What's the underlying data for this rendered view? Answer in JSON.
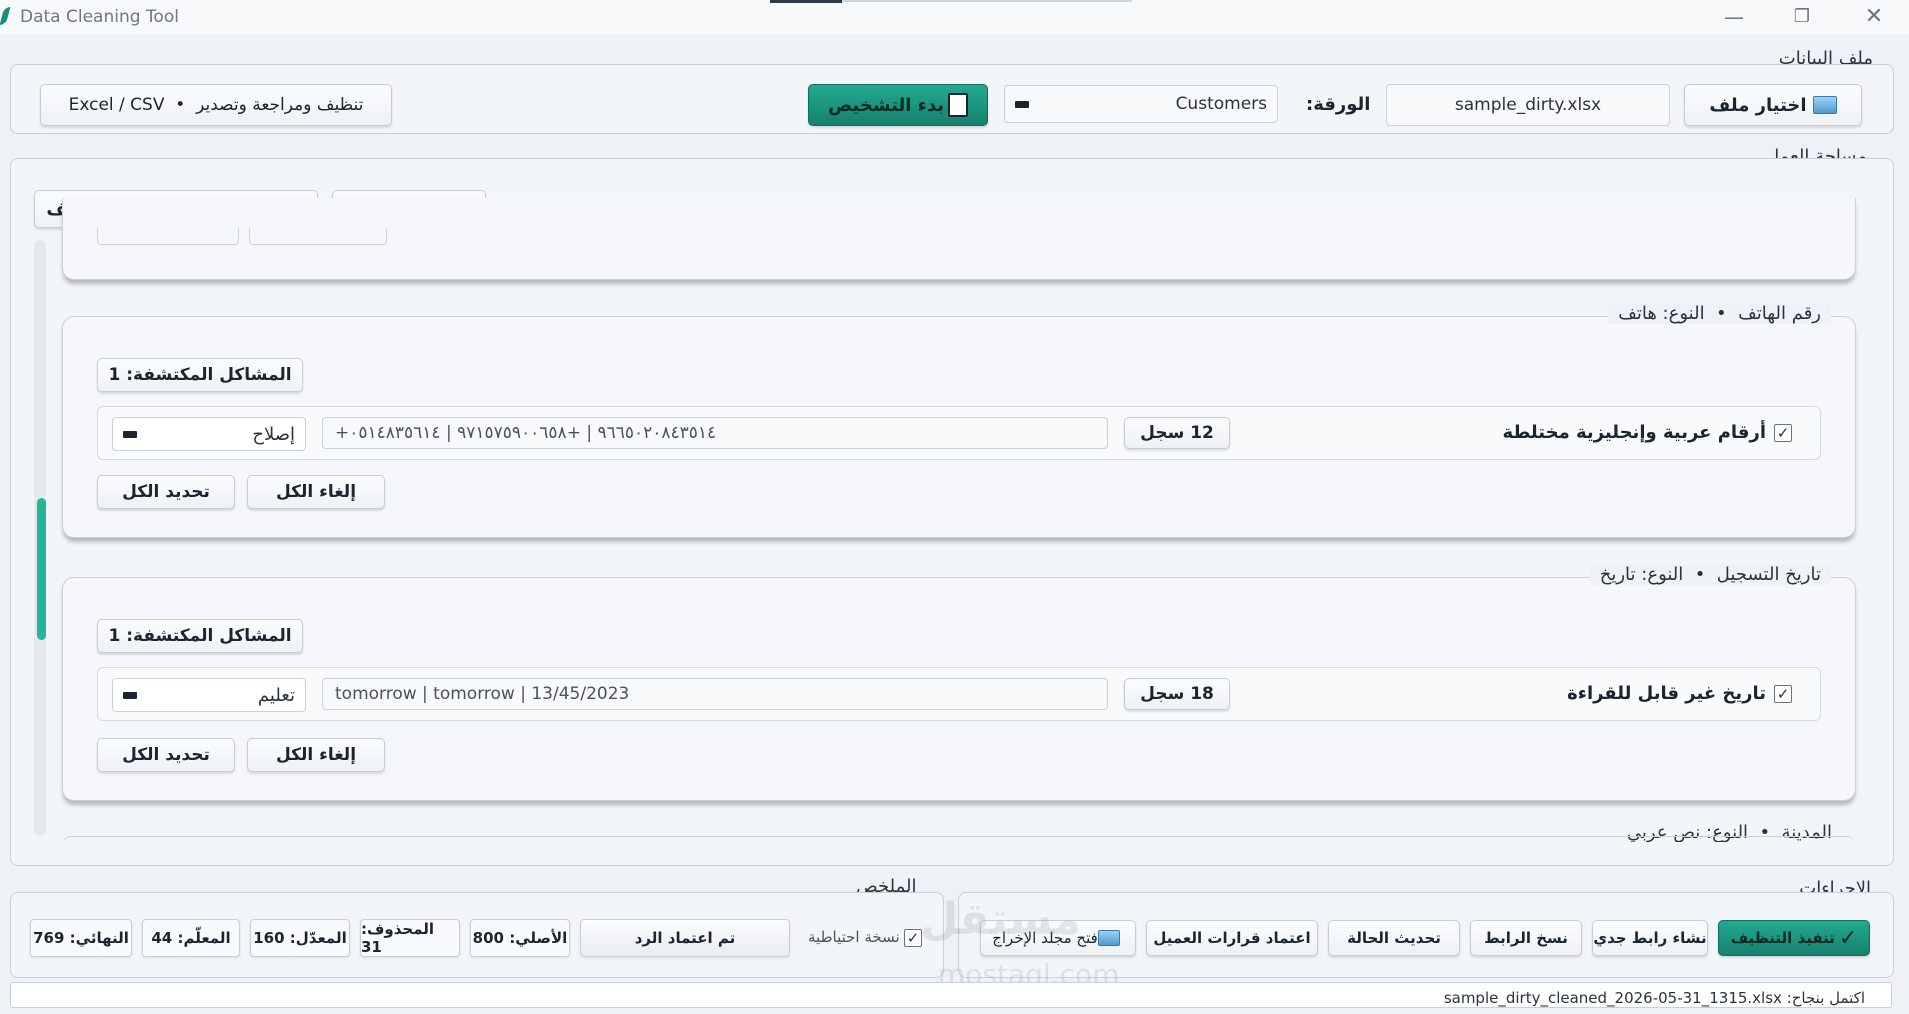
{
  "window": {
    "title": "Data Cleaning Tool",
    "min_glyph": "—",
    "max_glyph": "❐",
    "close_glyph": "✕"
  },
  "file_section": {
    "label": "ملف البيانات",
    "choose_file_label": "اختيار ملف",
    "file_name": "sample_dirty.xlsx",
    "sheet_label": "الورقة:",
    "sheet_value": "Customers",
    "diagnose_label": "بدء التشخيص",
    "tagline": "تنظيف ومراجعة وتصدير  •  Excel / CSV"
  },
  "workspace": {
    "label": "مساحة العمل",
    "select_all_issues": "تحديد كل المشاكل في الملف",
    "deselect_all": "إلغاء الكل",
    "cards": [
      {
        "title": "رقم الهاتف  •  النوع: هاتف",
        "issues_count": "المشاكل المكتشفة: 1",
        "issue_label": "أرقام عربية وإنجليزية مختلطة",
        "record_count": "12 سجل",
        "samples": "+٩٦٦٥٠٢٠٨٤٣٥١٤ | +٩٧١٥٧٥٩٠٠٦٥٨ | ٠٥١٤٨٣٥٦١٤",
        "action": "إصلاح",
        "checked": "✓",
        "deselect": "إلغاء الكل",
        "select": "تحديد الكل"
      },
      {
        "title": "تاريخ التسجيل  •  النوع: تاريخ",
        "issues_count": "المشاكل المكتشفة: 1",
        "issue_label": "تاريخ غير قابل للقراءة",
        "record_count": "18 سجل",
        "samples": "tomorrow | tomorrow | 13/45/2023",
        "action": "تعليم",
        "checked": "✓",
        "deselect": "إلغاء الكل",
        "select": "تحديد الكل"
      }
    ],
    "partial_card_title": "المدينة  •  النوع: نص عربي"
  },
  "actions": {
    "label": "الإجراءات",
    "run_cleaning": "تنفيذ التنظيف",
    "new_link": "نشاء رابط جدي",
    "copy_link": "نسخ الرابط",
    "refresh_status": "تحديث الحالة",
    "approve_client": "اعتماد قرارات العميل",
    "open_output": "فتح مجلد الإخراج"
  },
  "summary": {
    "label": "الملخص",
    "backup_label": "نسخة احتياطية",
    "backup_checked": "✓",
    "reply_status": "تم اعتماد الرد",
    "original": "الأصلي: 800",
    "deleted": "المحذوف: 31",
    "modified": "المعدّل: 160",
    "flagged": "المعلّم: 44",
    "final": "النهائي: 769"
  },
  "status": {
    "text": "اكتمل بنجاح: sample_dirty_cleaned_2026-05-31_1315.xlsx"
  },
  "watermark": {
    "ar": "مستقل",
    "en": "mostaql.com"
  }
}
